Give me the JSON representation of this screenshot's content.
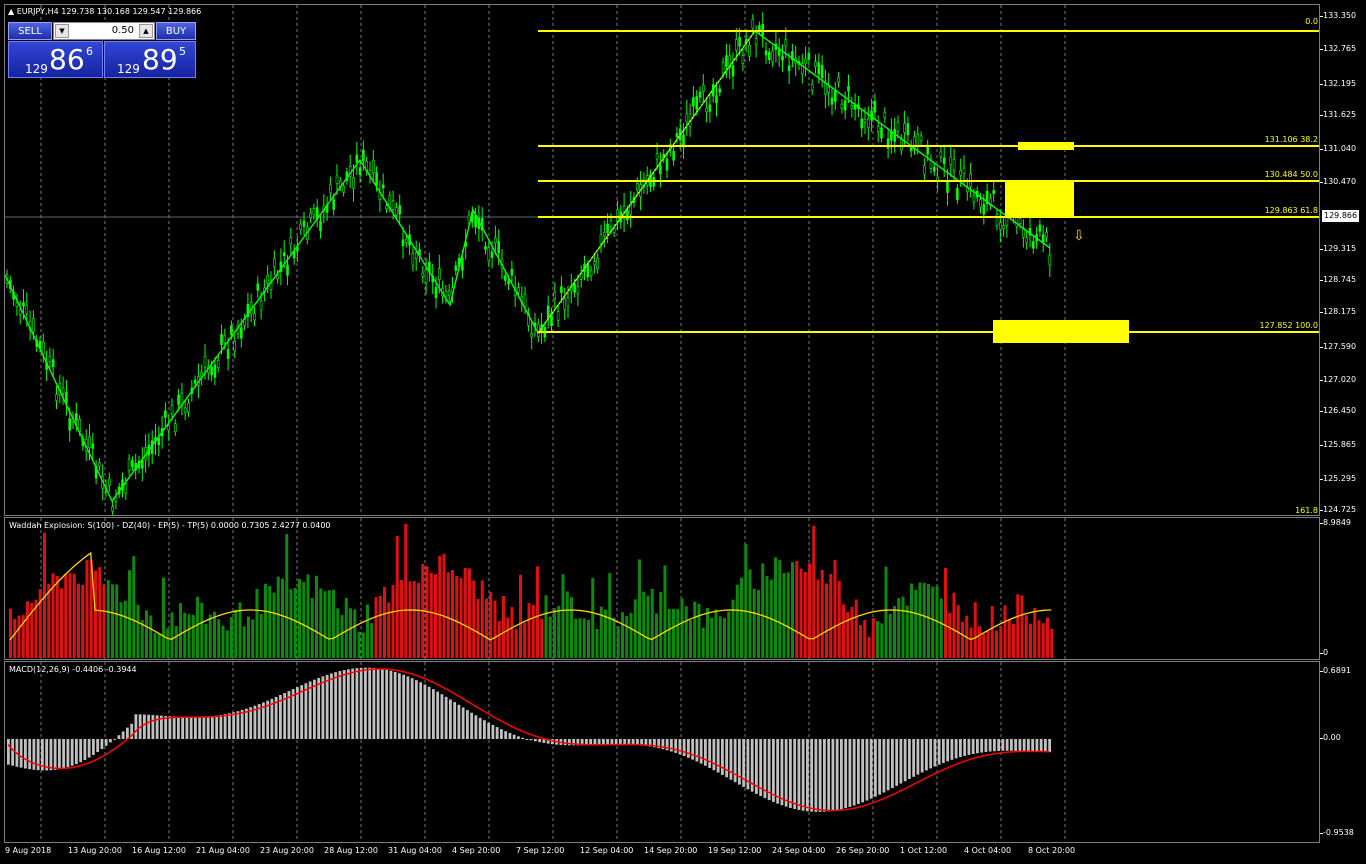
{
  "symbol_line": {
    "collapse_icon": "triangle-up-icon",
    "text": "EURJPY,H4  129.738 130.168 129.547 129.866"
  },
  "trade_panel": {
    "sell_label": "SELL",
    "buy_label": "BUY",
    "lot_value": "0.50",
    "bid": {
      "prefix": "129",
      "big": "86",
      "sup": "6"
    },
    "ask": {
      "prefix": "129",
      "big": "89",
      "sup": "5"
    }
  },
  "colors": {
    "candle": "#00ff00",
    "zigzag": "#00ff00",
    "fib": "#ffff00",
    "grid": "#c8c8c8",
    "wae_up": "#0b8a0b",
    "wae_down": "#e01010",
    "wae_line": "#ffd700",
    "macd_hist": "#c0c0c0",
    "macd_signal": "#ff0000"
  },
  "price_axis": [
    "133.350",
    "132.765",
    "132.195",
    "131.625",
    "131.040",
    "130.470",
    "129.866",
    "129.315",
    "128.745",
    "128.175",
    "127.590",
    "127.020",
    "126.450",
    "125.865",
    "125.295",
    "124.725"
  ],
  "current_price": "129.866",
  "fib_levels": [
    {
      "label": "0.0"
    },
    {
      "label": "131.106  38.2"
    },
    {
      "label": "130.484  50.0"
    },
    {
      "label": "129.863  61.8"
    },
    {
      "label": "127.852  100.0"
    },
    {
      "label": "161.8"
    }
  ],
  "sell_arrow_icon": "arrow-down-icon",
  "wae": {
    "title": "Waddah Explosion: S(100) - DZ(40) - EP(5) - TP(5) 0.0000 0.7305 2.4277 0.0400",
    "axis_top": "8.9849",
    "axis_zero": "0"
  },
  "macd": {
    "title": "MACD(12,26,9) -0.4406 -0.3944",
    "axis_top": "0.6891",
    "axis_mid": "0.00",
    "axis_bottom": "-0.9538"
  },
  "time_axis": [
    "9 Aug 2018",
    "13 Aug 20:00",
    "16 Aug 12:00",
    "21 Aug 04:00",
    "23 Aug 20:00",
    "28 Aug 12:00",
    "31 Aug 04:00",
    "4 Sep 20:00",
    "7 Sep 12:00",
    "12 Sep 04:00",
    "14 Sep 20:00",
    "19 Sep 12:00",
    "24 Sep 04:00",
    "26 Sep 20:00",
    "1 Oct 12:00",
    "4 Oct 04:00",
    "8 Oct 20:00"
  ]
}
